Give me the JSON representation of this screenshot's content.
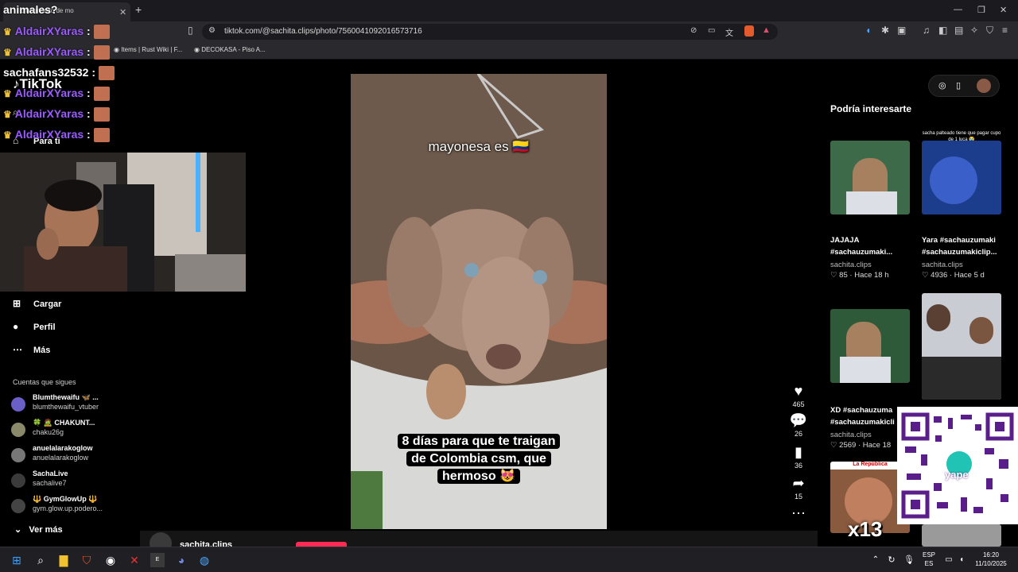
{
  "browser": {
    "tab_title": "o hermanito de mo",
    "url": "tiktok.com/@sachita.clips/photo/7560041092016573716",
    "bookmarks": [
      "Items | Rust Wiki | F...",
      "DECOKASA - Piso A..."
    ]
  },
  "sidebar": {
    "logo": "TikTok",
    "nav": [
      {
        "label": "Para ti",
        "icon": "home-icon"
      },
      {
        "label": "Cargar",
        "icon": "upload-icon"
      },
      {
        "label": "Perfil",
        "icon": "profile-icon"
      },
      {
        "label": "Más",
        "icon": "more-icon"
      }
    ],
    "following_title": "Cuentas que sigues",
    "accounts": [
      {
        "name": "Blumthewaifu 🦋 ...",
        "handle": "blumthewaifu_vtuber"
      },
      {
        "name": "🍀 🧟 CHAKUNT...",
        "handle": "chaku26g"
      },
      {
        "name": "anuelalarakoglow",
        "handle": "anuelalarakoglow"
      },
      {
        "name": "SachaLive",
        "handle": "sachalive7"
      },
      {
        "name": "🔱 GymGlowUp 🔱",
        "handle": "gym.glow.up.podero..."
      }
    ],
    "see_more": "Ver más"
  },
  "post": {
    "caption_top": "mayonesa es 🇨🇴",
    "caption_bottom_lines": [
      "8 días para que te traigan",
      "de Colombia csm, que",
      "hermoso 😻"
    ],
    "likes": "465",
    "comments": "26",
    "saves": "36",
    "shares": "15",
    "author_partial": "sachita.clips"
  },
  "recommendations": {
    "title": "Podría interesarte",
    "cards": [
      {
        "title_l1": "JAJAJA",
        "title_l2": "#sachauzumaki...",
        "author": "sachita.clips",
        "likes": "85",
        "time": "Hace 18 h",
        "overlay": ""
      },
      {
        "title_l1": "Yara #sachauzumaki",
        "title_l2": "#sachauzumakiclip...",
        "author": "sachita.clips",
        "likes": "4936",
        "time": "Hace 5 d",
        "overlay": "sacha palteado tiene que pagar cupo de 1 luca 😭"
      },
      {
        "title_l1": "XD #sachauzuma",
        "title_l2": "#sachauzumakicli",
        "author": "sachita.clips",
        "likes": "2569",
        "time": "Hace 18",
        "overlay": ""
      }
    ]
  },
  "stream_overlay": {
    "title_fragment": "animales?",
    "chat": [
      {
        "user": "AldairXYaras",
        "crown": true
      },
      {
        "user": "AldairXYaras",
        "crown": true
      },
      {
        "user": "sachafans32532",
        "crown": false
      },
      {
        "user": "AldairXYaras",
        "crown": true
      },
      {
        "user": "AldairXYaras",
        "crown": true
      },
      {
        "user": "AldairXYaras",
        "crown": true
      }
    ],
    "sep": ":",
    "combo": "x13",
    "qr_brand": "yape",
    "news_label": "La República"
  },
  "taskbar": {
    "lang_l1": "ESP",
    "lang_l2": "ES",
    "time": "16:20",
    "date": "11/10/2025"
  }
}
